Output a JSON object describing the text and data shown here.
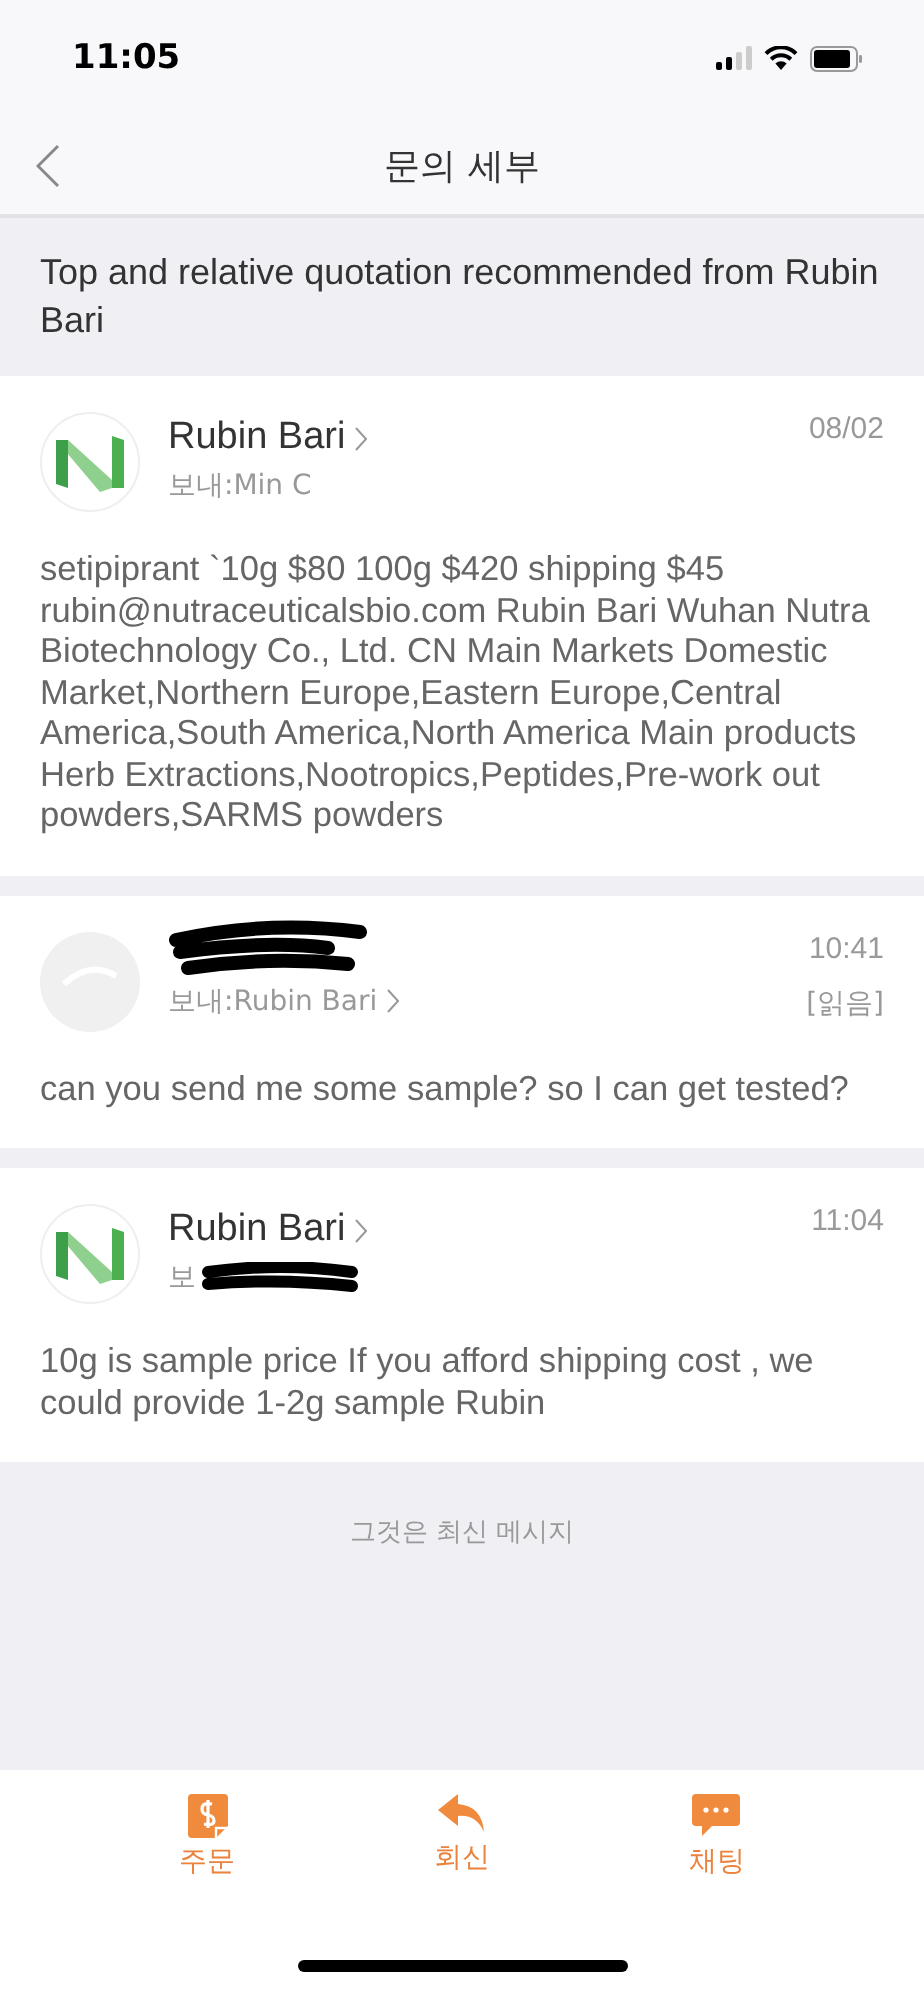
{
  "status_bar": {
    "time": "11:05"
  },
  "nav": {
    "title": "문의 세부"
  },
  "subject": "Top and relative quotation recommended from Rubin Bari",
  "messages": [
    {
      "kind": "logo",
      "sender": "Rubin Bari",
      "sender_redacted": false,
      "recipient": "보내:Min C",
      "recipient_redacted": false,
      "time": "08/02",
      "body": "setipiprant `10g $80 100g $420  shipping $45 rubin@nutraceuticalsbio.com Rubin Bari Wuhan Nutra Biotechnology Co., Ltd. CN Main Markets Domestic Market,Northern Europe,Eastern Europe,Central America,South America,North America Main products Herb Extractions,Nootropics,Peptides,Pre-work out powders,SARMS powders"
    },
    {
      "kind": "plain",
      "sender_redacted": true,
      "recipient": "보내:Rubin Bari",
      "recipient_redacted": false,
      "time": "10:41",
      "receipt": "[읽음]",
      "body": "can you send me some sample? so I can get tested?"
    },
    {
      "kind": "logo",
      "sender": "Rubin Bari",
      "sender_redacted": false,
      "recipient": "보",
      "recipient_redacted": true,
      "time": "11:04",
      "body": "10g is sample price If you afford shipping cost , we could provide 1-2g sample Rubin"
    }
  ],
  "end_note": "그것은 최신 메시지",
  "toolbar": [
    {
      "kind": "order",
      "label": "주문"
    },
    {
      "kind": "reply",
      "label": "회신"
    },
    {
      "kind": "chat",
      "label": "채팅"
    }
  ]
}
